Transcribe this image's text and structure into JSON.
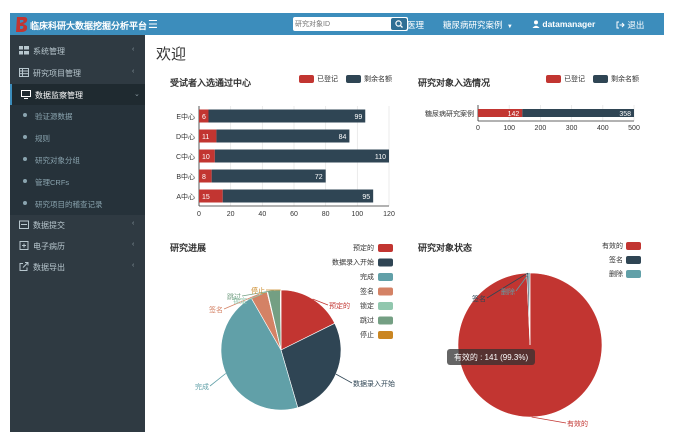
{
  "header": {
    "title": "临床科研大数据挖掘分析平台",
    "search_placeholder": "研究对象ID",
    "nav": [
      "医理",
      "糖尿病研究案例"
    ],
    "user": "datamanager",
    "logout": "退出",
    "color": "#3c8dbc"
  },
  "sidebar": {
    "items": [
      {
        "label": "系统管理",
        "icon": "grid-icon"
      },
      {
        "label": "研究项目管理",
        "icon": "table-icon"
      },
      {
        "label": "数据监察管理",
        "icon": "monitor-icon"
      }
    ],
    "subitems": [
      "验证源数据",
      "规则",
      "研究对象分组",
      "管理CRFs",
      "研究项目的稽查记录"
    ],
    "bottom_items": [
      {
        "label": "数据提交",
        "icon": "upload-icon"
      },
      {
        "label": "电子病历",
        "icon": "record-icon"
      },
      {
        "label": "数据导出",
        "icon": "export-icon"
      }
    ]
  },
  "page": {
    "heading": "欢迎"
  },
  "panels": {
    "enroll_center": "受试者入选通过中心",
    "enroll_subject": "研究对象入选情况",
    "progress": "研究进展",
    "status": "研究对象状态"
  },
  "colors": {
    "registered": "#c23531",
    "remaining": "#2f4554",
    "teal": "#61a0a8",
    "orange": "#d48265",
    "green": "#91c7ae",
    "gray_green": "#749f83",
    "gold": "#ca8622"
  },
  "chart_data": [
    {
      "type": "bar",
      "orientation": "horizontal",
      "stacked": true,
      "categories": [
        "E中心",
        "D中心",
        "C中心",
        "B中心",
        "A中心"
      ],
      "series": [
        {
          "name": "已登记",
          "values": [
            6,
            11,
            10,
            8,
            15
          ]
        },
        {
          "name": "剩余名额",
          "values": [
            99,
            84,
            110,
            72,
            95
          ]
        }
      ],
      "xlim": [
        0,
        120
      ],
      "xticks": [
        "0",
        "20",
        "40",
        "60",
        "80",
        "100",
        "120"
      ],
      "legend_position": "top-right"
    },
    {
      "type": "bar",
      "orientation": "horizontal",
      "stacked": true,
      "categories": [
        "糖尿病研究案例"
      ],
      "series": [
        {
          "name": "已登记",
          "values": [
            142
          ]
        },
        {
          "name": "剩余名额",
          "values": [
            358
          ]
        }
      ],
      "xlim": [
        0,
        500
      ],
      "xticks": [
        "0",
        "100",
        "200",
        "300",
        "400",
        "500"
      ],
      "legend_position": "top-right"
    },
    {
      "type": "pie",
      "labels": [
        "预定的",
        "数据录入开始",
        "完成",
        "签名",
        "锁定",
        "跳过",
        "停止"
      ],
      "values": [
        47,
        74,
        123,
        12,
        0.5,
        9,
        0.5
      ],
      "outer_labels": [
        "预定的",
        "数据录入开始",
        "完成",
        "签名",
        "锁定",
        "跳过",
        "停止"
      ],
      "legend_position": "right"
    },
    {
      "type": "pie",
      "labels": [
        "有效的",
        "签名",
        "删除"
      ],
      "values": [
        141,
        0.6,
        0.4
      ],
      "outer_labels": [
        "有效的",
        "签名",
        "删除"
      ],
      "tooltip": "有效的 : 141 (99.3%)",
      "legend_position": "top-right"
    }
  ]
}
